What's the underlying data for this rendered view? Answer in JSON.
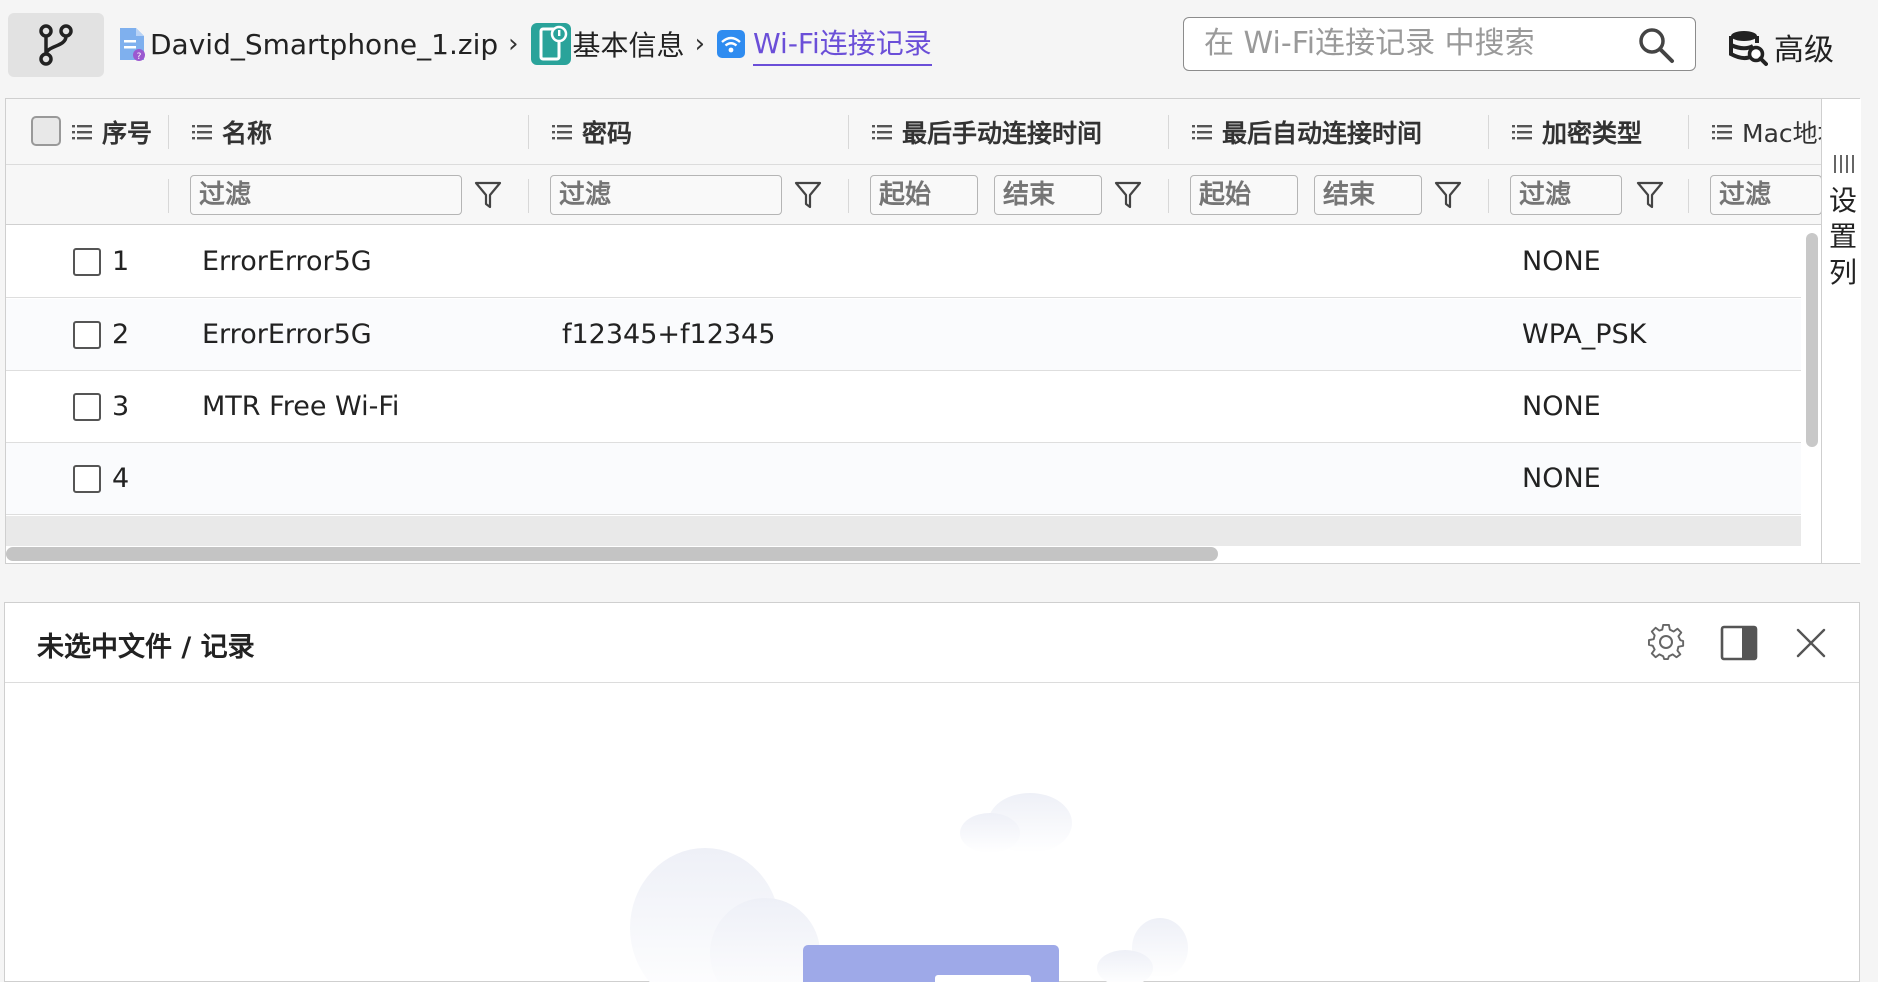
{
  "breadcrumb": {
    "items": [
      {
        "label": "David_Smartphone_1.zip",
        "icon": "zip-file-icon"
      },
      {
        "label": "基本信息",
        "icon": "phone-info-icon"
      },
      {
        "label": "Wi-Fi连接记录",
        "icon": "wifi-icon"
      }
    ],
    "separator": "›"
  },
  "search": {
    "placeholder": "在 Wi-Fi连接记录 中搜索"
  },
  "toolbar": {
    "advanced_label": "高级"
  },
  "table": {
    "columns": [
      {
        "label": "序号"
      },
      {
        "label": "名称"
      },
      {
        "label": "密码"
      },
      {
        "label": "最后手动连接时间"
      },
      {
        "label": "最后自动连接时间"
      },
      {
        "label": "加密类型"
      },
      {
        "label": "Mac地址"
      }
    ],
    "filter_placeholder": "过滤",
    "range_start": "起始",
    "range_end": "结束",
    "rows": [
      {
        "index": "1",
        "name": "ErrorError5G",
        "password": "",
        "encryption": "NONE"
      },
      {
        "index": "2",
        "name": "ErrorError5G",
        "password": "f12345+f12345",
        "encryption": "WPA_PSK"
      },
      {
        "index": "3",
        "name": "MTR Free Wi-Fi",
        "password": "",
        "encryption": "NONE"
      },
      {
        "index": "4",
        "name": "",
        "password": "",
        "encryption": "NONE"
      }
    ],
    "column_settings_label": "设置列"
  },
  "detail_panel": {
    "title": "未选中文件 / 记录"
  },
  "colors": {
    "accent": "#6b4fd8",
    "wifi_blue": "#2f8cf0",
    "illustration": "#9ea9e8"
  }
}
